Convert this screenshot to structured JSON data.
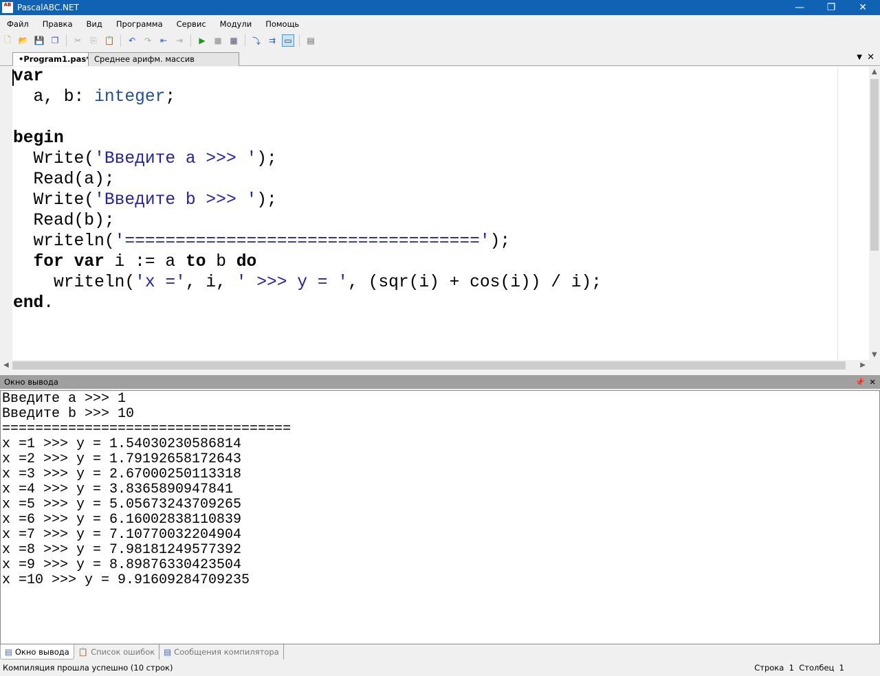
{
  "window": {
    "title": "PascalABC.NET",
    "logo_text": "AB"
  },
  "menu": [
    "Файл",
    "Правка",
    "Вид",
    "Программа",
    "Сервис",
    "Модули",
    "Помощь"
  ],
  "toolbar": [
    {
      "icon": "new-file-icon",
      "glyph": "🗋",
      "color": "#c8a040"
    },
    {
      "icon": "open-folder-icon",
      "glyph": "📂",
      "color": "#d0a030"
    },
    {
      "icon": "save-icon",
      "glyph": "💾",
      "color": "#3050a0"
    },
    {
      "icon": "save-all-icon",
      "glyph": "❐",
      "color": "#3050a0"
    },
    {
      "sep": true
    },
    {
      "icon": "cut-icon",
      "glyph": "✂",
      "color": "#aaa"
    },
    {
      "icon": "copy-icon",
      "glyph": "⎘",
      "color": "#aaa"
    },
    {
      "icon": "paste-icon",
      "glyph": "📋",
      "color": "#c09040"
    },
    {
      "sep": true
    },
    {
      "icon": "undo-icon",
      "glyph": "↶",
      "color": "#2060c0"
    },
    {
      "icon": "redo-icon",
      "glyph": "↷",
      "color": "#aaa"
    },
    {
      "icon": "indent-left-icon",
      "glyph": "⇤",
      "color": "#2060c0"
    },
    {
      "icon": "indent-right-icon",
      "glyph": "⇥",
      "color": "#aaa"
    },
    {
      "sep": true
    },
    {
      "icon": "run-icon",
      "glyph": "▶",
      "color": "#1a9a1a"
    },
    {
      "icon": "stop-icon",
      "glyph": "■",
      "color": "#aaa"
    },
    {
      "icon": "compile-icon",
      "glyph": "▦",
      "color": "#557"
    },
    {
      "sep": true
    },
    {
      "icon": "step-into-icon",
      "glyph": "⤵",
      "color": "#2060c0"
    },
    {
      "icon": "step-over-icon",
      "glyph": "⇉",
      "color": "#2060c0"
    },
    {
      "icon": "console-icon",
      "glyph": "▭",
      "color": "#333",
      "active": true
    },
    {
      "sep": true
    },
    {
      "icon": "form-designer-icon",
      "glyph": "▤",
      "color": "#666"
    }
  ],
  "tabs": [
    {
      "label": "•Program1.pas*",
      "active": true
    },
    {
      "label": "Среднее арифм. массив введён.pas",
      "active": false
    }
  ],
  "code": [
    [
      [
        "var",
        "kw"
      ]
    ],
    [
      [
        "  a, b: ",
        ""
      ],
      [
        "integer",
        "ty"
      ],
      [
        ";",
        ""
      ]
    ],
    [],
    [
      [
        "begin",
        "kw"
      ]
    ],
    [
      [
        "  Write(",
        ""
      ],
      [
        "'Введите a >>> '",
        "str"
      ],
      [
        ");",
        ""
      ]
    ],
    [
      [
        "  Read(a);",
        ""
      ]
    ],
    [
      [
        "  Write(",
        ""
      ],
      [
        "'Введите b >>> '",
        "str"
      ],
      [
        ");",
        ""
      ]
    ],
    [
      [
        "  Read(b);",
        ""
      ]
    ],
    [
      [
        "  writeln(",
        ""
      ],
      [
        "'==================================='",
        "str"
      ],
      [
        ");",
        ""
      ]
    ],
    [
      [
        "  ",
        ""
      ],
      [
        "for",
        "kw"
      ],
      [
        " ",
        ""
      ],
      [
        "var",
        "kw"
      ],
      [
        " i := a ",
        ""
      ],
      [
        "to",
        "kw"
      ],
      [
        " b ",
        ""
      ],
      [
        "do",
        "kw"
      ]
    ],
    [
      [
        "    writeln(",
        ""
      ],
      [
        "'x ='",
        "str"
      ],
      [
        ", i, ",
        ""
      ],
      [
        "' >>> y = '",
        "str"
      ],
      [
        ", (sqr(i) + cos(i)) / i);",
        ""
      ]
    ],
    [
      [
        "end",
        "kw"
      ],
      [
        ".",
        ""
      ]
    ]
  ],
  "output_panel": {
    "title": "Окно вывода",
    "lines": [
      "Введите a >>> 1",
      "Введите b >>> 10",
      "===================================",
      "x =1 >>> y = 1.54030230586814",
      "x =2 >>> y = 1.79192658172643",
      "x =3 >>> y = 2.67000250113318",
      "x =4 >>> y = 3.8365890947841",
      "x =5 >>> y = 5.05673243709265",
      "x =6 >>> y = 6.16002838110839",
      "x =7 >>> y = 7.10770032204904",
      "x =8 >>> y = 7.98181249577392",
      "x =9 >>> y = 8.89876330423504",
      "x =10 >>> y = 9.91609284709235"
    ]
  },
  "bottom_tabs": [
    {
      "label": "Окно вывода",
      "active": true
    },
    {
      "label": "Список ошибок",
      "active": false
    },
    {
      "label": "Сообщения компилятора",
      "active": false
    }
  ],
  "status": {
    "message": "Компиляция прошла успешно (10 строк)",
    "line_label": "Строка",
    "line": "1",
    "col_label": "Столбец",
    "col": "1"
  }
}
